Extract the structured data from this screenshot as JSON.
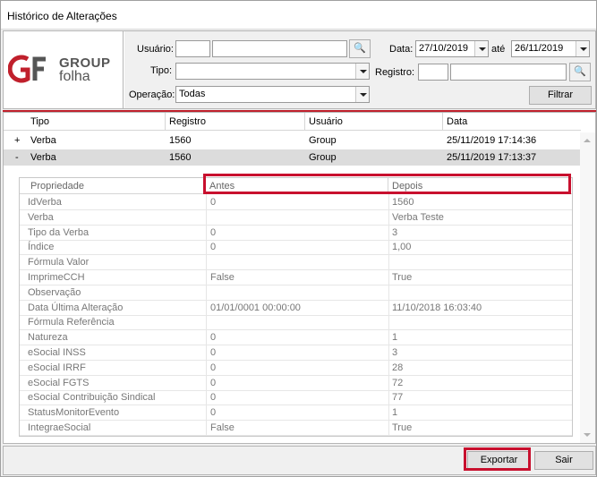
{
  "window": {
    "title": "Histórico de Alterações"
  },
  "logo": {
    "line1": "GROUP",
    "line2": "folha"
  },
  "filters": {
    "usuario_label": "Usuário:",
    "usuario_code": "",
    "usuario_name": "",
    "tipo_label": "Tipo:",
    "tipo_value": "",
    "operacao_label": "Operação:",
    "operacao_value": "Todas",
    "data_label": "Data:",
    "data_from": "27/10/2019",
    "ate_label": "até",
    "data_to": "26/11/2019",
    "registro_label": "Registro:",
    "registro_code": "",
    "registro_name": "",
    "filtrar_label": "Filtrar",
    "search_icon_glyph": "🔍"
  },
  "grid": {
    "columns": [
      "Tipo",
      "Registro",
      "Usuário",
      "Data"
    ],
    "rows": [
      {
        "expander": "+",
        "tipo": "Verba",
        "registro": "1560",
        "usuario": "Group",
        "data": "25/11/2019 17:14:36"
      },
      {
        "expander": "-",
        "tipo": "Verba",
        "registro": "1560",
        "usuario": "Group",
        "data": "25/11/2019 17:13:37"
      }
    ]
  },
  "detail": {
    "columns": [
      "Propriedade",
      "Antes",
      "Depois"
    ],
    "rows": [
      [
        "IdVerba",
        "0",
        "1560"
      ],
      [
        "Verba",
        "",
        "Verba Teste"
      ],
      [
        "Tipo da Verba",
        "0",
        "3"
      ],
      [
        "Índice",
        "0",
        "1,00"
      ],
      [
        "Fórmula Valor",
        "",
        ""
      ],
      [
        "ImprimeCCH",
        "False",
        "True"
      ],
      [
        "Observação",
        "",
        ""
      ],
      [
        "Data Última Alteração",
        "01/01/0001 00:00:00",
        "11/10/2018 16:03:40"
      ],
      [
        "Fórmula Referência",
        "",
        ""
      ],
      [
        "Natureza",
        "0",
        "1"
      ],
      [
        "eSocial INSS",
        "0",
        "3"
      ],
      [
        "eSocial IRRF",
        "0",
        "28"
      ],
      [
        "eSocial FGTS",
        "0",
        "72"
      ],
      [
        "eSocial Contribuição Sindical",
        "0",
        "77"
      ],
      [
        "StatusMonitorEvento",
        "0",
        "1"
      ],
      [
        "IntegraeSocial",
        "False",
        "True"
      ]
    ]
  },
  "footer": {
    "exportar_label": "Exportar",
    "sair_label": "Sair"
  },
  "colors": {
    "highlight_red": "#c8102e",
    "accent_red": "#c0202c",
    "selected_row": "#dcdcdc"
  }
}
